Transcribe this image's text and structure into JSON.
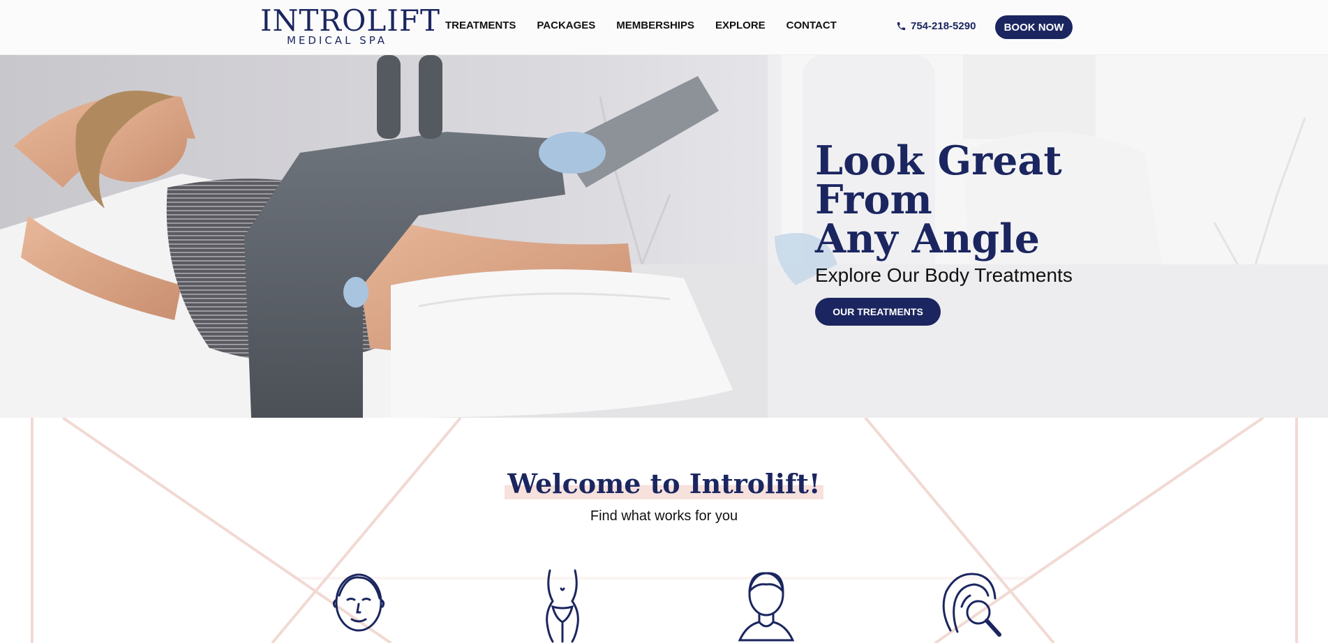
{
  "brand": {
    "name": "INTROLIFT",
    "sub": "MEDICAL SPA"
  },
  "nav": [
    {
      "label": "TREATMENTS"
    },
    {
      "label": "PACKAGES"
    },
    {
      "label": "MEMBERSHIPS"
    },
    {
      "label": "EXPLORE"
    },
    {
      "label": "CONTACT"
    }
  ],
  "header": {
    "phone": "754-218-5290",
    "book_label": "BOOK NOW"
  },
  "hero": {
    "title": "Look Great From\nAny Angle",
    "subtitle": "Explore Our Body Treatments",
    "button": "OUR TREATMENTS"
  },
  "welcome": {
    "title": "Welcome to Introlift!",
    "subtitle": "Find what works for you"
  },
  "categories": [
    {
      "icon": "face-icon"
    },
    {
      "icon": "body-icon"
    },
    {
      "icon": "man-icon"
    },
    {
      "icon": "hair-search-icon"
    }
  ],
  "colors": {
    "navy": "#1b2660",
    "blush": "#f0d6cf",
    "white": "#ffffff"
  }
}
